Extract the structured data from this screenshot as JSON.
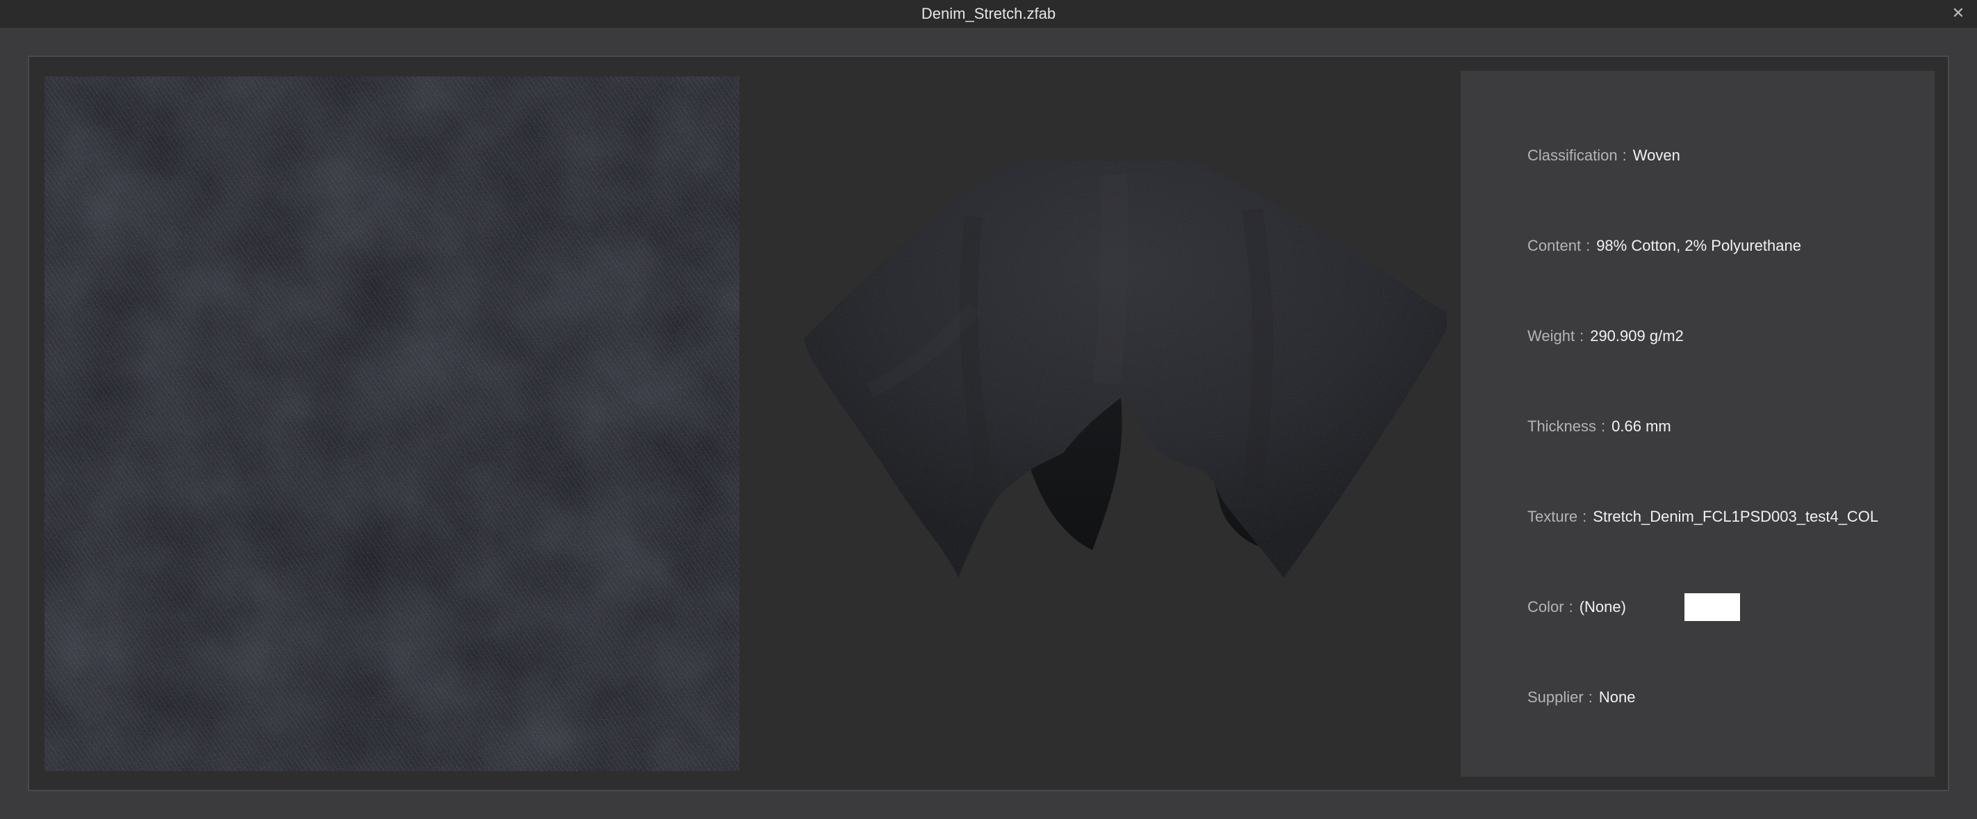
{
  "window": {
    "title": "Denim_Stretch.zfab",
    "close_glyph": "✕"
  },
  "icons": {
    "close": "close-icon"
  },
  "colors": {
    "titlebar": "#2b2b2b",
    "background": "#3b3b3d",
    "viewport": "#2e2e2e",
    "panel": "#3c3c3e",
    "fabric": "#1f2026",
    "color_swatch": "#ffffff"
  },
  "fabric_info": {
    "separator": ":",
    "classification": {
      "label": "Classification",
      "value": "Woven"
    },
    "content": {
      "label": "Content",
      "value": "98% Cotton, 2% Polyurethane"
    },
    "weight": {
      "label": "Weight",
      "value": "290.909 g/m2"
    },
    "thickness": {
      "label": "Thickness",
      "value": "0.66 mm"
    },
    "texture": {
      "label": "Texture",
      "value": "Stretch_Denim_FCL1PSD003_test4_COL"
    },
    "color": {
      "label": "Color",
      "value": "(None)"
    },
    "supplier": {
      "label": "Supplier",
      "value": "None"
    }
  }
}
